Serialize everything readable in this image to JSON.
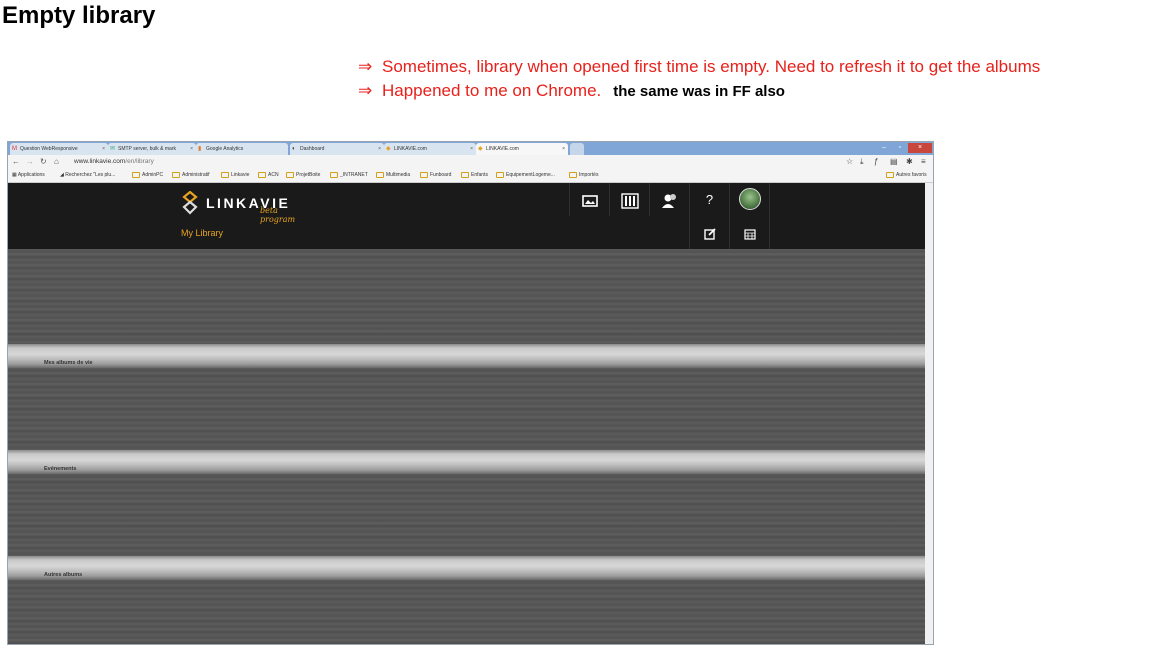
{
  "doc": {
    "title": "Empty library",
    "note1": "Sometimes, library when opened first time is empty. Need to refresh it to get the albums",
    "note2": "Happened to me on Chrome.",
    "note2_extra": "the same was in FF also",
    "arrow": "⇒"
  },
  "browser": {
    "tabs": [
      {
        "label": "Question WebResponsive",
        "icon": "gmail-icon"
      },
      {
        "label": "SMTP server, bulk & mark",
        "icon": "mail-icon"
      },
      {
        "label": "Google Analytics",
        "icon": "analytics-icon"
      },
      {
        "label": "Dashboard",
        "icon": "dashboard-icon"
      },
      {
        "label": "LINKAVIE.com",
        "icon": "linkavie-icon"
      },
      {
        "label": "LINKAVIE.com",
        "icon": "linkavie-icon"
      }
    ],
    "url_host": "www.linkavie.com",
    "url_path": "/en/library",
    "bookmarks": [
      "Applications",
      "Recherchez \"Les plu...",
      "AdminPC",
      "Administratif",
      "Linkavie",
      "ACN",
      "ProjetBoite",
      "_INTRANET",
      "Multimedia",
      "Funboard",
      "Enfants",
      "EquipementLogeme...",
      "Importés"
    ],
    "other_bookmarks": "Autres favoris"
  },
  "site": {
    "logo_text": "LINKAVIE",
    "logo_beta": "beta program",
    "breadcrumb": "My Library",
    "help_label": "?",
    "shelves": [
      "Mes albums de vie",
      "Evénements",
      "Autres albums"
    ]
  },
  "colors": {
    "accent": "#e8a320",
    "note_red": "#e8211b",
    "header_bg": "#1a1a1a"
  }
}
